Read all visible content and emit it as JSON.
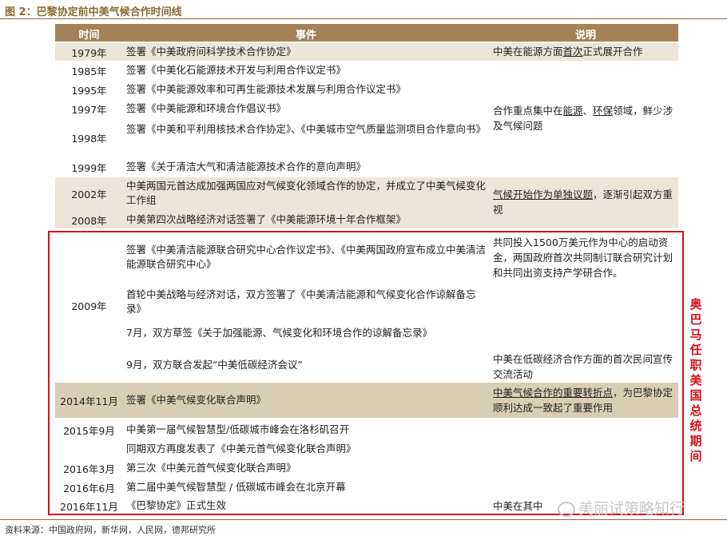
{
  "title": "图 2：巴黎协定前中美气候合作时间线",
  "header": {
    "time": "时间",
    "event": "事件",
    "note": "说明"
  },
  "rows": {
    "r1979": {
      "year": "1979年",
      "event": "签署《中美政府间科学技术合作协定》",
      "note_a": "中美在能源方面",
      "note_u": "首次",
      "note_b": "正式展开合作"
    },
    "r1985": {
      "year": "1985年",
      "event": "签署《中美化石能源技术开发与利用合作议定书》"
    },
    "r1995": {
      "year": "1995年",
      "event": "签署《中美能源效率和可再生能源技术发展与利用合作议定书》"
    },
    "r1997": {
      "year": "1997年",
      "event": "签署《中美能源和环境合作倡议书》",
      "note_a": "合作重点集中在",
      "note_u1": "能源",
      "note_sep": "、",
      "note_u2": "环保",
      "note_b": "领域，鲜少涉及气候问题"
    },
    "r1998": {
      "year": "1998年",
      "event": "签署《中美和平利用核技术合作协定》、《中美城市空气质量监测项目合作意向书》"
    },
    "r1999": {
      "year": "1999年",
      "event": "签署《关于清洁大气和清洁能源技术合作的意向声明》"
    },
    "r2002": {
      "year": "2002年",
      "event": "中美两国元首达成加强两国应对气候变化领域合作的协定，并成立了中美气候变化工作组",
      "note_u": "气候开始作为单独议题",
      "note_b": "，逐渐引起双方重视"
    },
    "r2008": {
      "year": "2008年",
      "event": "中美第四次战略经济对话签署了《中美能源环境十年合作框架》"
    },
    "r2009": {
      "year": "2009年",
      "event1": "签署《中美清洁能源联合研究中心合作议定书》、《中美两国政府宣布成立中美清洁能源联合研究中心》",
      "event2": "首轮中美战略与经济对话，双方签署了《中美清洁能源和气候变化合作谅解备忘录》",
      "event3": "7月，双方草签《关于加强能源、气候变化和环境合作的谅解备忘录》",
      "event4": "9月，双方联合发起“中美低碳经济会议”",
      "note1": "共同投入1500万美元作为中心的启动资金，两国政府首次共同制订联合研究计划和共同出资支持产学研合作。",
      "note2": "中美在低碳经济合作方面的首次民间宣传交流活动"
    },
    "r2014": {
      "year": "2014年11月",
      "event": "签署《中美气候变化联合声明》",
      "note_u": "中美气候合作的重要转折点",
      "note_b": "，为巴黎协定顺利达成一致起了重要作用"
    },
    "r2015": {
      "year": "2015年9月",
      "event1": "中美第一届气候智慧型/低碳城市峰会在洛杉矶召开",
      "event2": "同期双方再度发表了《中美元首气候变化联合声明》"
    },
    "r2016a": {
      "year": "2016年3月",
      "event": "第三次《中美元首气候变化联合声明》"
    },
    "r2016b": {
      "year": "2016年6月",
      "event": "第二届中美气候智慧型 / 低碳城市峰会在北京开幕"
    },
    "r2016c": {
      "year": "2016年11月",
      "event": "《巴黎协定》正式生效",
      "note": "中美在其中"
    }
  },
  "side_label": "奥巴马任职美国总统期间",
  "source": "资料来源：中国政府网，新华网，人民网，德邦研究所",
  "watermark": "美丽试策略知行",
  "colors": {
    "accent": "#a48257",
    "title": "#8b6a34",
    "highlight": "#d4101d",
    "shade": "#ebe6d8",
    "tan_row": "#d9ceb3"
  }
}
